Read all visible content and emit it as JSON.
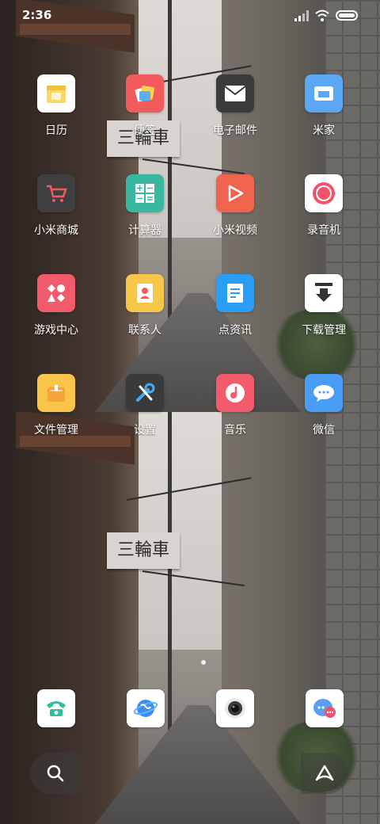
{
  "status_bar": {
    "time": "2:36"
  },
  "apps": [
    {
      "label": "日历",
      "icon": "calendar-icon",
      "bg": "#ffffff"
    },
    {
      "label": "便签",
      "icon": "notes-icon",
      "bg": "#f25b5b"
    },
    {
      "label": "电子邮件",
      "icon": "email-icon",
      "bg": "#3b3b3b"
    },
    {
      "label": "米家",
      "icon": "mijia-icon",
      "bg": "#5aa7f5"
    },
    {
      "label": "小米商城",
      "icon": "shop-cart-icon",
      "bg": "#3f3f3f"
    },
    {
      "label": "计算器",
      "icon": "calculator-icon",
      "bg": "#39b7a1"
    },
    {
      "label": "小米视频",
      "icon": "video-play-icon",
      "bg": "#f0634d"
    },
    {
      "label": "录音机",
      "icon": "recorder-icon",
      "bg": "#ffffff"
    },
    {
      "label": "游戏中心",
      "icon": "game-center-icon",
      "bg": "#f25b6b"
    },
    {
      "label": "联系人",
      "icon": "contacts-icon",
      "bg": "#f6c64b"
    },
    {
      "label": "点资讯",
      "icon": "news-icon",
      "bg": "#2a9df4"
    },
    {
      "label": "下载管理",
      "icon": "download-icon",
      "bg": "#ffffff"
    },
    {
      "label": "文件管理",
      "icon": "file-manager-icon",
      "bg": "#f8c44a"
    },
    {
      "label": "设置",
      "icon": "settings-icon",
      "bg": "#3a3a3a"
    },
    {
      "label": "音乐",
      "icon": "music-icon",
      "bg": "#f25b6b"
    },
    {
      "label": "微信",
      "icon": "chat-bubble-icon",
      "bg": "#4a9df5"
    }
  ],
  "dock": [
    {
      "icon": "phone-icon"
    },
    {
      "icon": "browser-icon"
    },
    {
      "icon": "camera-icon"
    },
    {
      "icon": "messages-icon"
    }
  ],
  "bottom": {
    "search_icon": "search-icon",
    "assistant_icon": "assistant-icon"
  },
  "wallpaper": {
    "sign_text": "三輪車"
  }
}
